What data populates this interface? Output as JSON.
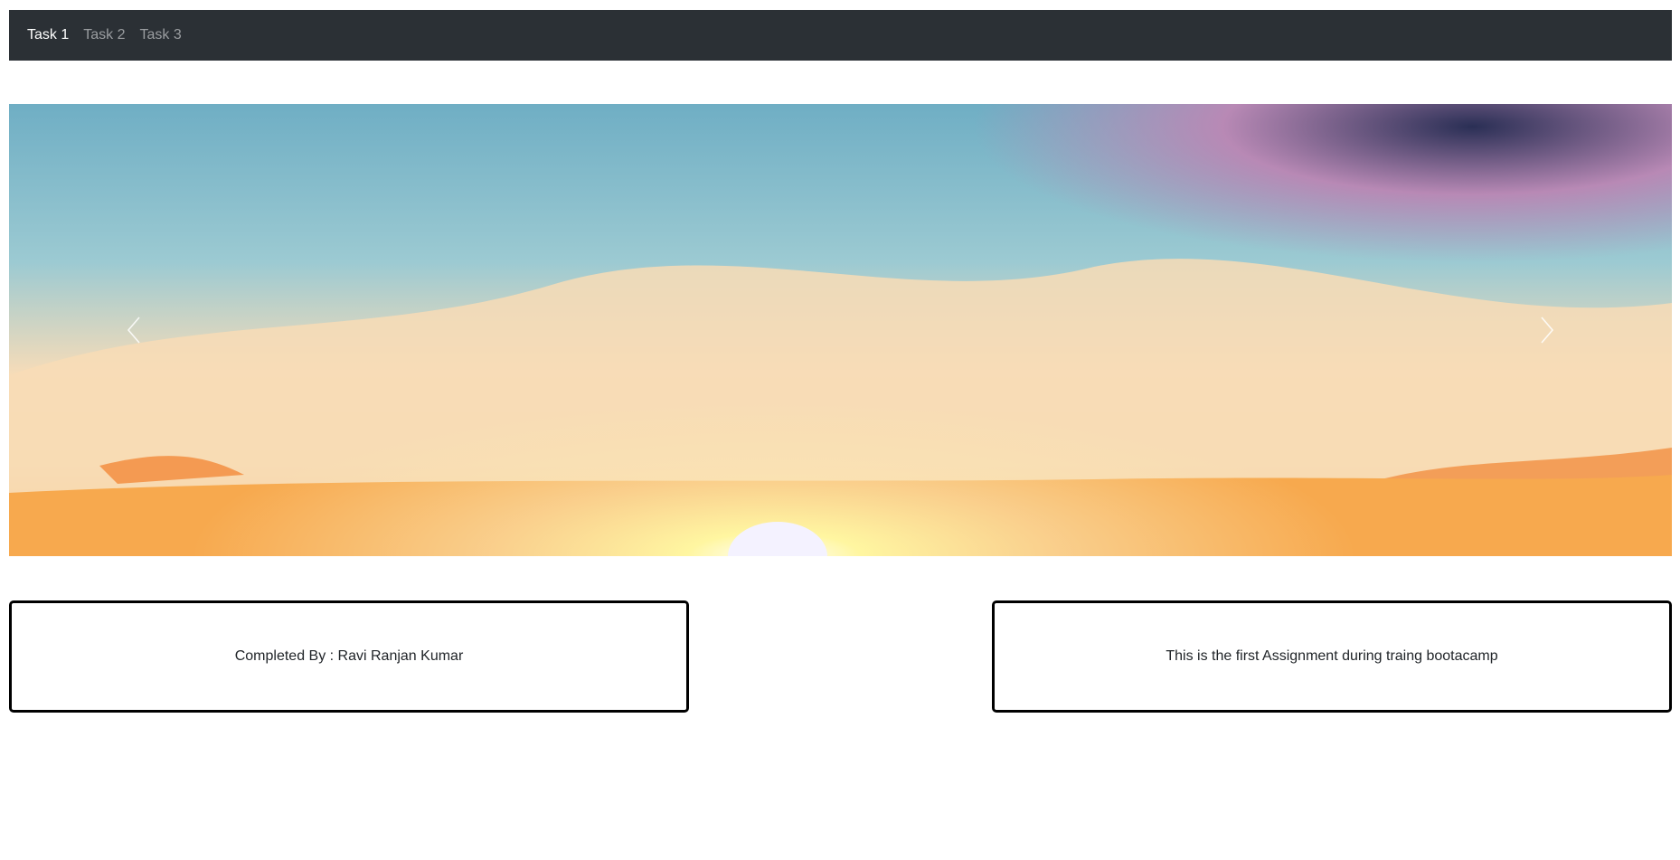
{
  "navbar": {
    "links": [
      {
        "label": "Task 1",
        "active": true
      },
      {
        "label": "Task 2",
        "active": false
      },
      {
        "label": "Task 3",
        "active": false
      }
    ],
    "background": "#2b3035"
  },
  "carousel": {
    "image": "sunset-sky-watercolor",
    "prev_icon": "chevron-left-icon",
    "next_icon": "chevron-right-icon"
  },
  "boxes": {
    "left_text": "Completed By : Ravi Ranjan Kumar",
    "right_text": "This is the first Assignment during traing bootacamp"
  }
}
